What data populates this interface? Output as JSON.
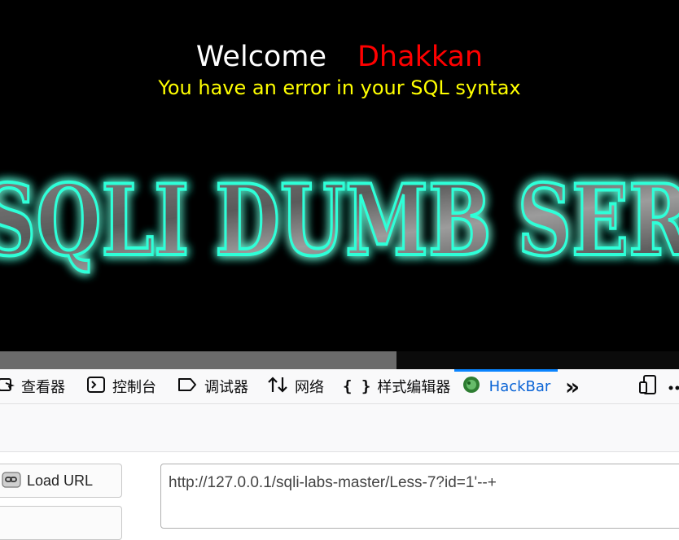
{
  "page": {
    "welcome_word": "Welcome",
    "user_name": "Dhakkan",
    "error_message": "You have an error in your SQL syntax",
    "logo_text": "SQLI DUMB SERIES"
  },
  "devtools": {
    "tabs": [
      {
        "label": "查看器",
        "icon": "inspector-icon"
      },
      {
        "label": "控制台",
        "icon": "console-icon"
      },
      {
        "label": "调试器",
        "icon": "debugger-icon"
      },
      {
        "label": "网络",
        "icon": "network-icon"
      },
      {
        "label": "样式编辑器",
        "icon": "style-editor-icon"
      },
      {
        "label": "HackBar",
        "icon": "hackbar-icon",
        "active": true
      }
    ],
    "overflow_label": "»"
  },
  "hackbar": {
    "load_url_label": "Load URL",
    "url_value": "http://127.0.0.1/sqli-labs-master/Less-7?id=1'--+"
  },
  "colors": {
    "page_bg": "#000000",
    "welcome": "#ffffff",
    "user_name": "#ff0000",
    "error": "#ffff00",
    "logo_glow": "#2fffd8",
    "active_tab": "#0a84ff"
  }
}
